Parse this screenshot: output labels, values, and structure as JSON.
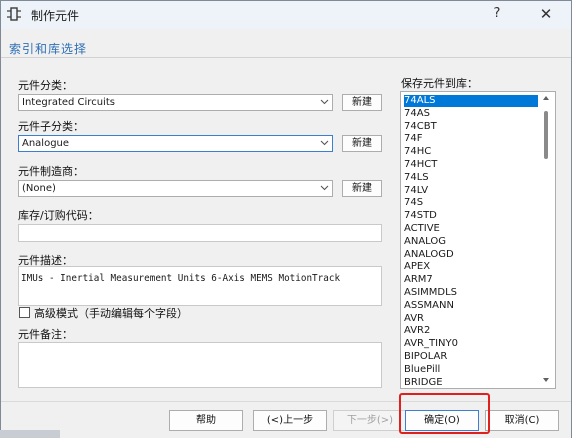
{
  "window": {
    "title": "制作元件",
    "help_glyph": "?",
    "close_glyph": "✕"
  },
  "section_title": "索引和库选择",
  "category": {
    "label": "元件分类：",
    "value": "Integrated Circuits",
    "new_label": "新建"
  },
  "subcategory": {
    "label": "元件子分类：",
    "value": "Analogue",
    "new_label": "新建"
  },
  "manufacturer": {
    "label": "元件制造商：",
    "value": "(None)",
    "new_label": "新建"
  },
  "stock_code": {
    "label": "库存/订购代码：",
    "value": ""
  },
  "description": {
    "label": "元件描述：",
    "value": "IMUs - Inertial Measurement Units 6-Axis MEMS MotionTrack"
  },
  "advanced_mode": {
    "label": "高级模式（手动编辑每个字段）",
    "checked": false
  },
  "notes": {
    "label": "元件备注：",
    "value": ""
  },
  "library": {
    "label": "保存元件到库：",
    "selected": "74ALS",
    "items": [
      "74ALS",
      "74AS",
      "74CBT",
      "74F",
      "74HC",
      "74HCT",
      "74LS",
      "74LV",
      "74S",
      "74STD",
      "ACTIVE",
      "ANALOG",
      "ANALOGD",
      "APEX",
      "ARM7",
      "ASIMMDLS",
      "ASSMANN",
      "AVR",
      "AVR2",
      "AVR_TINY0",
      "BIPOLAR",
      "BluePill",
      "BRIDGE"
    ]
  },
  "footer": {
    "help": "帮助",
    "back": "(<)上一步",
    "next": "下一步(>)",
    "ok": "确定(O)",
    "cancel": "取消(C)"
  }
}
